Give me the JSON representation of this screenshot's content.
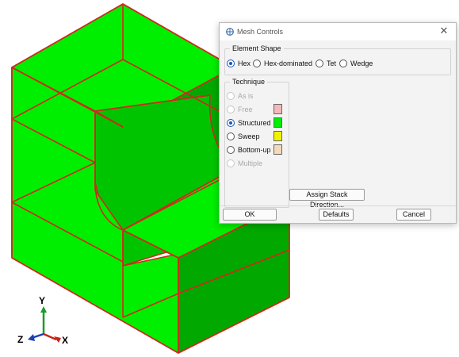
{
  "viewport": {
    "part_color": "#00ee00",
    "edge_color": "#cc2b1d",
    "triad": {
      "y_label": "Y",
      "z_label": "Z",
      "x_label": "X"
    }
  },
  "dialog": {
    "title": "Mesh Controls",
    "close_glyph": "✕",
    "element_shape": {
      "legend": "Element Shape",
      "options": [
        {
          "label": "Hex",
          "selected": true
        },
        {
          "label": "Hex-dominated",
          "selected": false
        },
        {
          "label": "Tet",
          "selected": false
        },
        {
          "label": "Wedge",
          "selected": false
        }
      ]
    },
    "technique": {
      "legend": "Technique",
      "options": [
        {
          "label": "As is",
          "enabled": false,
          "selected": false
        },
        {
          "label": "Free",
          "enabled": false,
          "selected": false,
          "swatch": "#f4b8b8"
        },
        {
          "label": "Structured",
          "enabled": true,
          "selected": true,
          "swatch": "#00ee00"
        },
        {
          "label": "Sweep",
          "enabled": true,
          "selected": false,
          "swatch": "#f2f200"
        },
        {
          "label": "Bottom-up",
          "enabled": true,
          "selected": false,
          "swatch": "#f5d9b8"
        },
        {
          "label": "Multiple",
          "enabled": false,
          "selected": false
        }
      ]
    },
    "assign_stack_label": "Assign Stack Direction...",
    "buttons": {
      "ok": "OK",
      "defaults": "Defaults",
      "cancel": "Cancel"
    }
  }
}
